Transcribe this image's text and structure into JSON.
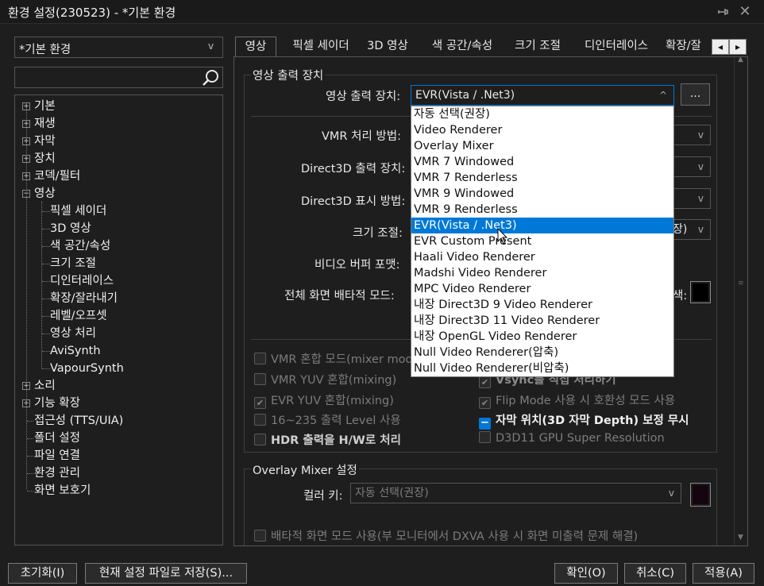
{
  "window": {
    "title": "환경 설정(230523) - *기본 환경",
    "pin_icon": "pin-icon",
    "close_icon": "close-icon"
  },
  "profile": {
    "selected": "*기본 환경",
    "arrow": "v"
  },
  "search": {
    "value": "",
    "icon": "search-icon"
  },
  "tree": {
    "items": [
      {
        "label": "기본",
        "expander": "+"
      },
      {
        "label": "재생",
        "expander": "+"
      },
      {
        "label": "자막",
        "expander": "+"
      },
      {
        "label": "장치",
        "expander": "+"
      },
      {
        "label": "코덱/필터",
        "expander": "+"
      },
      {
        "label": "영상",
        "expander": "−"
      },
      {
        "label": "픽셀 세이더"
      },
      {
        "label": "3D 영상"
      },
      {
        "label": "색 공간/속성"
      },
      {
        "label": "크기 조절"
      },
      {
        "label": "디인터레이스"
      },
      {
        "label": "확장/잘라내기"
      },
      {
        "label": "레벨/오프셋"
      },
      {
        "label": "영상 처리"
      },
      {
        "label": "AviSynth"
      },
      {
        "label": "VapourSynth"
      },
      {
        "label": "소리",
        "expander": "+"
      },
      {
        "label": "기능 확장",
        "expander": "+"
      },
      {
        "label": "접근성 (TTS/UIA)"
      },
      {
        "label": "폴더 설정"
      },
      {
        "label": "파일 연결"
      },
      {
        "label": "환경 관리"
      },
      {
        "label": "화면 보호기"
      }
    ]
  },
  "tabs": [
    "영상",
    "픽셀 세이더",
    "3D 영상",
    "색 공간/속성",
    "크기 조절",
    "디인터레이스",
    "확장/잘"
  ],
  "tab_scroll": {
    "left": "◂",
    "right": "▸"
  },
  "output_group": {
    "title": "영상 출력 장치",
    "device_label": "영상 출력 장치:",
    "device_value": "EVR(Vista / .Net3)",
    "device_arrow": "^",
    "more_button": "...",
    "vmr_label": "VMR 처리 방법:",
    "d3d_out_label": "Direct3D 출력 장치:",
    "d3d_show_label": "Direct3D 표시 방법:",
    "scale_label": "크기 조절:",
    "scale_tail": "장)",
    "buffer_label": "비디오 버퍼 포맷:",
    "fullscreen_label": "전체 화면 배타적 모드:",
    "color_tail": "색:",
    "color_swatch": "#000000"
  },
  "dropdown": {
    "options": [
      "자동 선택(권장)",
      "Video Renderer",
      "Overlay Mixer",
      "VMR 7 Windowed",
      "VMR 7 Renderless",
      "VMR 9 Windowed",
      "VMR 9 Renderless",
      "EVR(Vista / .Net3)",
      "EVR Custom Present",
      "Haali Video Renderer",
      "Madshi Video Renderer",
      "MPC Video Renderer",
      "내장 Direct3D 9 Video Renderer",
      "내장 Direct3D 11 Video Renderer",
      "내장 OpenGL Video Renderer",
      "Null Video Renderer(압축)",
      "Null Video Renderer(비압축)"
    ],
    "selected_index": 7
  },
  "checks_left": [
    {
      "label": "VMR 혼합 모드(mixer mod",
      "state": "off"
    },
    {
      "label": "VMR YUV 혼합(mixing)",
      "state": "off"
    },
    {
      "label": "EVR YUV 혼합(mixing)",
      "state": "on"
    },
    {
      "label": "16~235 출력 Level 사용",
      "state": "off"
    },
    {
      "label": "HDR 출력을 H/W로 처리",
      "state": "off"
    }
  ],
  "checks_right": [
    {
      "label": "Vsync를 직접 처리하기",
      "state": "on"
    },
    {
      "label": "Flip Mode 사용 시 호환성 모드 사용",
      "state": "on"
    },
    {
      "label": "자막 위치(3D 자막 Depth) 보정 무시",
      "state": "partial"
    },
    {
      "label": "D3D11 GPU Super Resolution",
      "state": "off"
    }
  ],
  "overlay_group": {
    "title": "Overlay Mixer 설정",
    "color_key_label": "컬러 키:",
    "color_key_value": "자동 선택(권장)",
    "color_key_swatch": "#140510",
    "exclusive_label": "배타적 화면 모드 사용(부 모니터에서 DXVA 사용 시 화면 미출력 문제 해결)"
  },
  "buttons": {
    "reset": "초기화(I)",
    "save_current": "현재 설정 파일로 저장(S)...",
    "ok": "확인(O)",
    "cancel": "취소(C)",
    "apply": "적용(A)"
  }
}
